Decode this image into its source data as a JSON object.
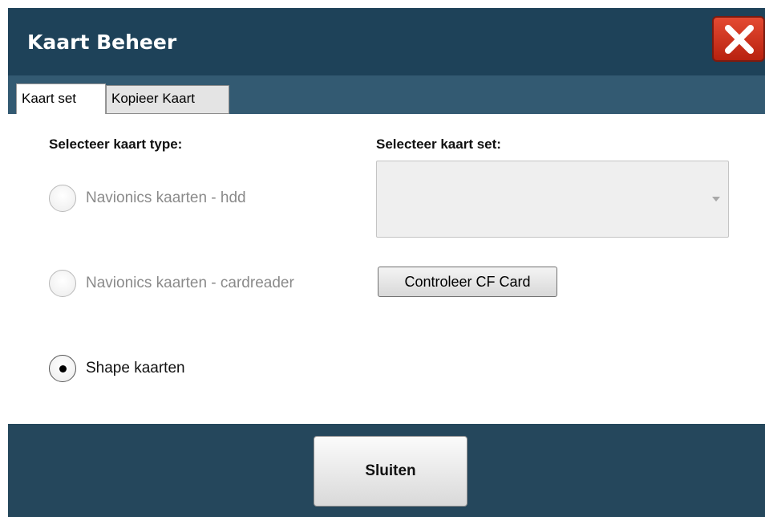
{
  "window": {
    "title": "Kaart Beheer"
  },
  "tabs": [
    {
      "label": "Kaart set",
      "active": true
    },
    {
      "label": "Kopieer Kaart",
      "active": false
    }
  ],
  "left_section": {
    "heading": "Selecteer kaart type:",
    "options": [
      {
        "label": "Navionics kaarten - hdd",
        "checked": false,
        "disabled": true
      },
      {
        "label": "Navionics kaarten - cardreader",
        "checked": false,
        "disabled": true
      },
      {
        "label": "Shape kaarten",
        "checked": true,
        "disabled": false
      }
    ]
  },
  "right_section": {
    "heading": "Selecteer kaart set:",
    "select_value": "",
    "check_button": "Controleer CF Card"
  },
  "footer": {
    "close_label": "Sluiten"
  },
  "colors": {
    "titlebar": "#1e4259",
    "close_red": "#d2331f"
  }
}
